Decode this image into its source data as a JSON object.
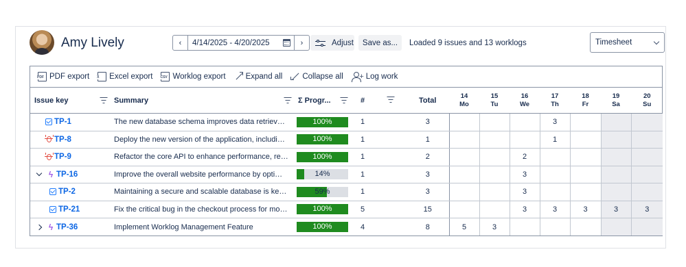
{
  "user": {
    "name": "Amy Lively"
  },
  "date_range": {
    "value": "4/14/2025 - 4/20/2025",
    "prev": "‹",
    "next": "›"
  },
  "actions": {
    "adjust": "Adjust",
    "save_as": "Save as..."
  },
  "status": "Loaded 9 issues and 13 worklogs",
  "view_select": {
    "selected": "Timesheet"
  },
  "toolbar": [
    {
      "label": "PDF export",
      "icon": "pdf-file-icon"
    },
    {
      "label": "Excel export",
      "icon": "excel-file-icon"
    },
    {
      "label": "Worklog export",
      "icon": "csv-file-icon"
    },
    {
      "label": "Expand all",
      "icon": "expand-arrows-icon"
    },
    {
      "label": "Collapse all",
      "icon": "collapse-arrows-icon"
    },
    {
      "label": "Log work",
      "icon": "add-person-icon"
    }
  ],
  "columns": {
    "issue_key": "Issue key",
    "summary": "Summary",
    "progress": "Σ Progr...",
    "count": "#",
    "total": "Total",
    "days": [
      {
        "num": "14",
        "dow": "Mo"
      },
      {
        "num": "15",
        "dow": "Tu"
      },
      {
        "num": "16",
        "dow": "We"
      },
      {
        "num": "17",
        "dow": "Th"
      },
      {
        "num": "18",
        "dow": "Fr"
      },
      {
        "num": "19",
        "dow": "Sa"
      },
      {
        "num": "20",
        "dow": "Su"
      }
    ]
  },
  "rows": [
    {
      "key": "TP-1",
      "type": "task",
      "summary": "The new database schema improves data retrieval t...",
      "progress": 100,
      "progress_label": "100%",
      "count": "1",
      "total": "3",
      "days": [
        "",
        "",
        "",
        "3",
        "",
        "",
        ""
      ]
    },
    {
      "key": "TP-8",
      "type": "bug",
      "summary": "Deploy the new version of the application, including...",
      "progress": 100,
      "progress_label": "100%",
      "count": "1",
      "total": "1",
      "days": [
        "",
        "",
        "",
        "1",
        "",
        "",
        ""
      ]
    },
    {
      "key": "TP-9",
      "type": "bug",
      "summary": "Refactor the core API to enhance performance, red...",
      "progress": 100,
      "progress_label": "100%",
      "count": "1",
      "total": "2",
      "days": [
        "",
        "",
        "2",
        "",
        "",
        "",
        ""
      ]
    },
    {
      "key": "TP-16",
      "type": "epic",
      "summary": "Improve the overall website performance by optimiz...",
      "progress": 14,
      "progress_label": "14%",
      "count": "1",
      "total": "3",
      "days": [
        "",
        "",
        "3",
        "",
        "",
        "",
        ""
      ],
      "toggle": "open"
    },
    {
      "key": "TP-2",
      "type": "task",
      "summary": "Maintaining a secure and scalable database is key t...",
      "progress": 59,
      "progress_label": "59%",
      "count": "1",
      "total": "3",
      "days": [
        "",
        "",
        "3",
        "",
        "",
        "",
        ""
      ],
      "level": 1
    },
    {
      "key": "TP-21",
      "type": "task",
      "summary": "Fix the critical bug in the checkout process for mobi...",
      "progress": 100,
      "progress_label": "100%",
      "count": "5",
      "total": "15",
      "days": [
        "",
        "",
        "3",
        "3",
        "3",
        "3",
        "3"
      ],
      "level": 1
    },
    {
      "key": "TP-36",
      "type": "epic",
      "summary": "Implement Worklog Management Feature",
      "progress": 100,
      "progress_label": "100%",
      "count": "4",
      "total": "8",
      "days": [
        "5",
        "3",
        "",
        "",
        "",
        "",
        ""
      ],
      "toggle": "closed"
    }
  ],
  "colors": {
    "progress_fill": "#1f8b1f",
    "key_link": "#0c66e4",
    "weekend": "#ebecf0"
  }
}
